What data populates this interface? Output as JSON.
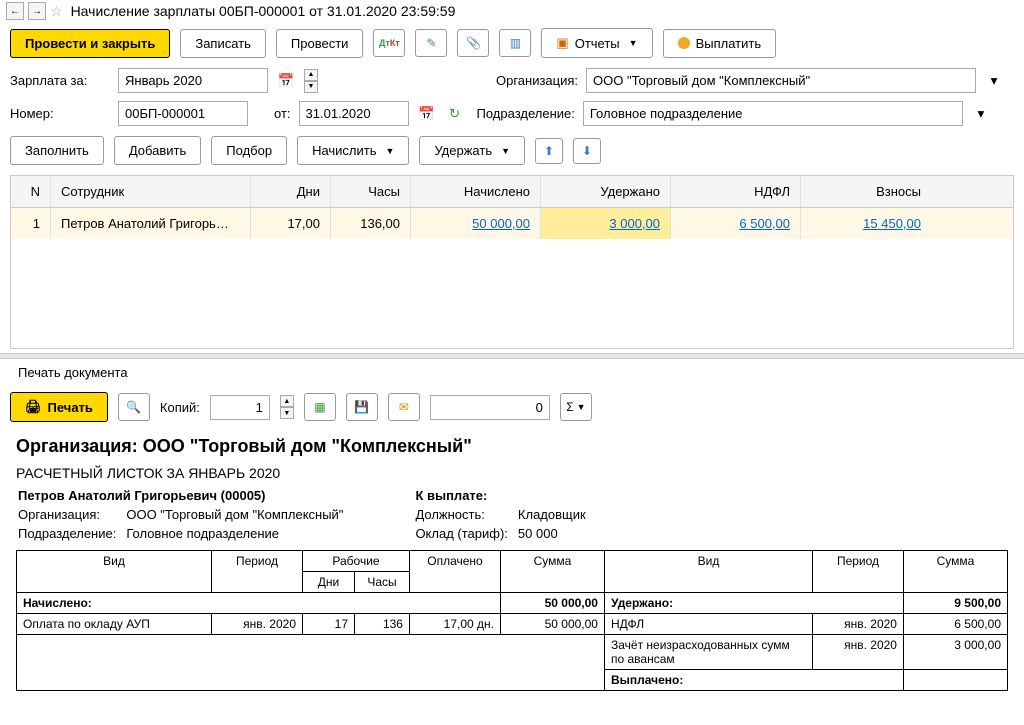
{
  "window": {
    "title": "Начисление зарплаты 00БП-000001 от 31.01.2020 23:59:59"
  },
  "toolbar": {
    "post_close": "Провести и закрыть",
    "save": "Записать",
    "post": "Провести",
    "reports": "Отчеты",
    "pay": "Выплатить"
  },
  "form": {
    "salary_for_label": "Зарплата за:",
    "salary_for": "Январь 2020",
    "org_label": "Организация:",
    "org": "ООО \"Торговый дом \"Комплексный\"",
    "number_label": "Номер:",
    "number": "00БП-000001",
    "date_label": "от:",
    "date": "31.01.2020",
    "dept_label": "Подразделение:",
    "dept": "Головное подразделение"
  },
  "table_toolbar": {
    "fill": "Заполнить",
    "add": "Добавить",
    "pick": "Подбор",
    "accrue": "Начислить",
    "withhold": "Удержать"
  },
  "grid": {
    "headers": [
      "N",
      "Сотрудник",
      "Дни",
      "Часы",
      "Начислено",
      "Удержано",
      "НДФЛ",
      "Взносы"
    ],
    "rows": [
      {
        "n": "1",
        "emp": "Петров Анатолий Григорь…",
        "days": "17,00",
        "hours": "136,00",
        "accrued": "50 000,00",
        "withheld": "3 000,00",
        "ndfl": "6 500,00",
        "contrib": "15 450,00"
      }
    ]
  },
  "print": {
    "section": "Печать документа",
    "print_btn": "Печать",
    "copies_label": "Копий:",
    "copies": "1",
    "sum_field": "0"
  },
  "doc": {
    "org_title": "Организация: ООО \"Торговый дом \"Комплексный\"",
    "slip_title": "РАСЧЕТНЫЙ ЛИСТОК ЗА ЯНВАРЬ 2020",
    "employee": "Петров Анатолий Григорьевич (00005)",
    "to_pay_label": "К выплате:",
    "info_left": {
      "org_label": "Организация:",
      "org": "ООО \"Торговый дом \"Комплексный\"",
      "dept_label": "Подразделение:",
      "dept": "Головное подразделение"
    },
    "info_right": {
      "pos_label": "Должность:",
      "pos": "Кладовщик",
      "salary_label": "Оклад (тариф):",
      "salary": "50 000"
    },
    "table": {
      "headers_left": [
        "Вид",
        "Период",
        "Рабочие",
        "Оплачено",
        "Сумма"
      ],
      "headers_left_sub": [
        "Дни",
        "Часы"
      ],
      "headers_right": [
        "Вид",
        "Период",
        "Сумма"
      ],
      "accrued_label": "Начислено:",
      "accrued_total": "50 000,00",
      "withheld_label": "Удержано:",
      "withheld_total": "9 500,00",
      "rows_left": [
        {
          "type": "Оплата по окладу АУП",
          "period": "янв. 2020",
          "days": "17",
          "hours": "136",
          "paid": "17,00 дн.",
          "sum": "50 000,00"
        }
      ],
      "rows_right": [
        {
          "type": "НДФЛ",
          "period": "янв. 2020",
          "sum": "6 500,00"
        },
        {
          "type": "Зачёт неизрасходованных сумм по авансам",
          "period": "янв. 2020",
          "sum": "3 000,00"
        }
      ],
      "paid_label": "Выплачено:"
    }
  }
}
